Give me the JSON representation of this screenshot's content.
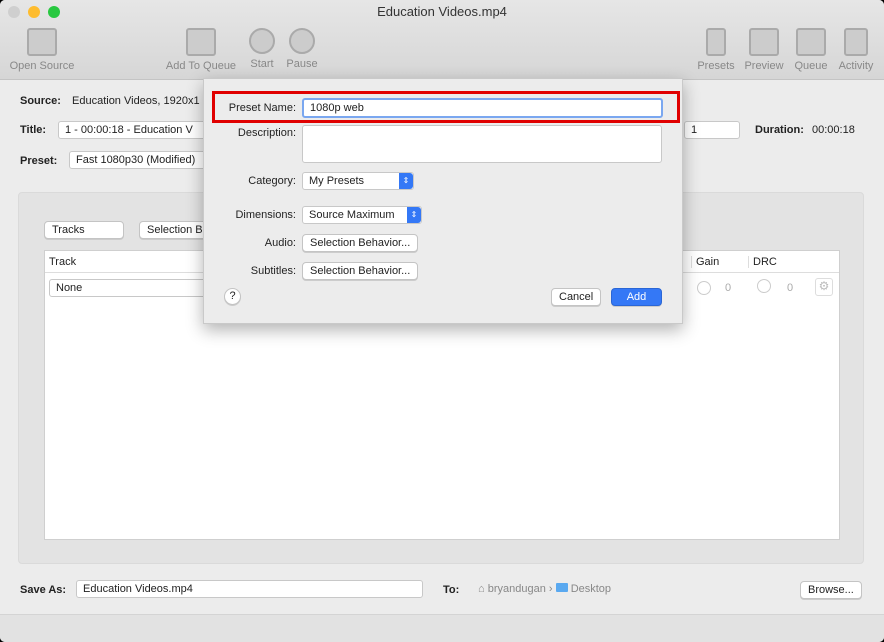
{
  "window": {
    "title": "Education Videos.mp4",
    "colors": {
      "close": "#ff5f57",
      "minimize": "#febc2e",
      "zoom": "#28c840"
    }
  },
  "toolbar": {
    "items": [
      {
        "label": "Open Source",
        "icon": "clapperboard-icon"
      },
      {
        "label": "Add To Queue",
        "icon": "add-to-queue-icon"
      },
      {
        "label": "Start",
        "icon": "play-icon"
      },
      {
        "label": "Pause",
        "icon": "pause-icon"
      },
      {
        "label": "Presets",
        "icon": "presets-icon"
      },
      {
        "label": "Preview",
        "icon": "preview-icon"
      },
      {
        "label": "Queue",
        "icon": "queue-icon"
      },
      {
        "label": "Activity",
        "icon": "activity-icon"
      }
    ]
  },
  "main": {
    "source_label": "Source:",
    "source_value": "Education Videos, 1920x1",
    "title_label": "Title:",
    "title_value": "1 - 00:00:18 - Education V",
    "angle_value": "1",
    "duration_label": "Duration:",
    "duration_value": "00:00:18",
    "preset_label": "Preset:",
    "preset_value": "Fast 1080p30 (Modified)",
    "tracks_select": "Tracks",
    "selection_button": "Selection B",
    "table_headers": [
      "Track",
      "Gain",
      "DRC"
    ],
    "row": {
      "track": "None",
      "gain": "0",
      "drc": "0"
    }
  },
  "sheet": {
    "preset_name_label": "Preset Name:",
    "preset_name_value": "1080p web",
    "description_label": "Description:",
    "description_value": "",
    "category_label": "Category:",
    "category_value": "My Presets",
    "dimensions_label": "Dimensions:",
    "dimensions_value": "Source Maximum",
    "audio_label": "Audio:",
    "audio_button": "Selection Behavior...",
    "subtitles_label": "Subtitles:",
    "subtitles_button": "Selection Behavior...",
    "help": "?",
    "cancel": "Cancel",
    "add": "Add",
    "highlight_color": "#e00000",
    "accent": "#3478f6"
  },
  "footer": {
    "save_as_label": "Save As:",
    "save_as_value": "Education Videos.mp4",
    "to_label": "To:",
    "path": [
      "bryandugan",
      "Desktop"
    ],
    "separator": "›",
    "browse": "Browse..."
  }
}
